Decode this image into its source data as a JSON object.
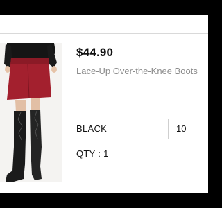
{
  "product": {
    "price": "$44.90",
    "name": "Lace-Up Over-the-Knee Boots",
    "color": "BLACK",
    "size": "10",
    "quantity": "QTY : 1"
  },
  "colors": {
    "background": "#000000",
    "card": "#ffffff",
    "price_text": "#111111",
    "name_text": "#8c8c8c",
    "skirt": "#a3202e",
    "boot": "#1b1b1b"
  }
}
